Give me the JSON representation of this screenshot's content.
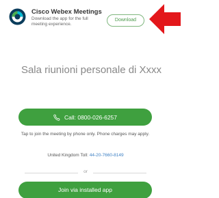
{
  "banner": {
    "app_name": "Cisco Webex Meetings",
    "description": "Download the app for the full meeting experience.",
    "download_label": "Download",
    "logo_icon": "webex-logo-icon",
    "arrow_color": "#e3171b"
  },
  "meeting": {
    "room_title": "Sala riunioni personale di Xxxx"
  },
  "call": {
    "button_label": "Call: 0800-026-6257",
    "icon": "phone-icon",
    "info_text": "Tap to join the meeting by phone only. Phone charges may apply.",
    "toll_label": "United Kingdom Toll:",
    "toll_number": "44-20-7660-8149"
  },
  "divider": {
    "label": "or"
  },
  "join": {
    "button_label": "Join via installed app"
  },
  "colors": {
    "accent_green": "#3fa03f",
    "link_blue": "#3b7fc4",
    "arrow_red": "#e3171b"
  }
}
